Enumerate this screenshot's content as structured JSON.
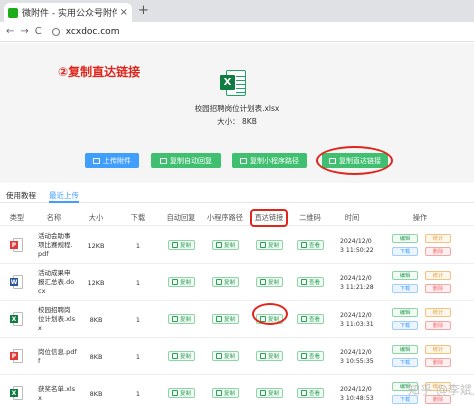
{
  "browser": {
    "tab_title": "微附件 - 实用公众号附件助手...",
    "close_glyph": "×",
    "newtab_glyph": "+",
    "back_glyph": "←",
    "forward_glyph": "→",
    "reload_glyph": "C",
    "url": "xcxdoc.com"
  },
  "annotation": "②复制直达链接",
  "file": {
    "name": "校园招聘岗位计划表.xlsx",
    "size": "大小：  8KB",
    "icon_letter": "X"
  },
  "actions": {
    "upload": "上传附件",
    "copy_reply": "复制自动回复",
    "copy_miniprogram": "复制小程序路径",
    "copy_link": "复制直达链接"
  },
  "subtabs": [
    "使用教程",
    "最近上传"
  ],
  "table": {
    "headers": [
      "类型",
      "名称",
      "大小",
      "下载",
      "自动回复",
      "小程序路径",
      "直达链接",
      "二维码",
      "时间",
      "操作"
    ],
    "copy_label": "复制",
    "view_label": "查看",
    "op_labels": {
      "edit": "编辑",
      "stat": "统计",
      "download": "下载",
      "delete": "删除"
    },
    "rows": [
      {
        "type": "pdf",
        "type_letter": "P",
        "type_color": "#e03a3a",
        "name": "活动会助事\n项比赛规程.\npdf",
        "size": "12KB",
        "downloads": "1",
        "time": "2024/12/0\n3 11:50:22"
      },
      {
        "type": "doc",
        "type_letter": "W",
        "type_color": "#2b579a",
        "name": "活动成果申\n报汇总表.do\ncx",
        "size": "12KB",
        "downloads": "1",
        "time": "2024/12/0\n3 11:21:28"
      },
      {
        "type": "xlsx",
        "type_letter": "X",
        "type_color": "#107c41",
        "name": "校园招聘岗\n位计划表.xls\nx",
        "size": "8KB",
        "downloads": "1",
        "time": "2024/12/0\n3 11:03:31"
      },
      {
        "type": "pdf",
        "type_letter": "P",
        "type_color": "#e03a3a",
        "name": "岗位信息.pdf\nf",
        "size": "8KB",
        "downloads": "1",
        "time": "2024/12/0\n3 10:55:35"
      },
      {
        "type": "xlsx",
        "type_letter": "X",
        "type_color": "#107c41",
        "name": "获奖名单.xls\nx",
        "size": "8KB",
        "downloads": "1",
        "time": "2024/12/0\n3 10:48:53"
      }
    ]
  },
  "watermark": "知乎 @李斌儿"
}
